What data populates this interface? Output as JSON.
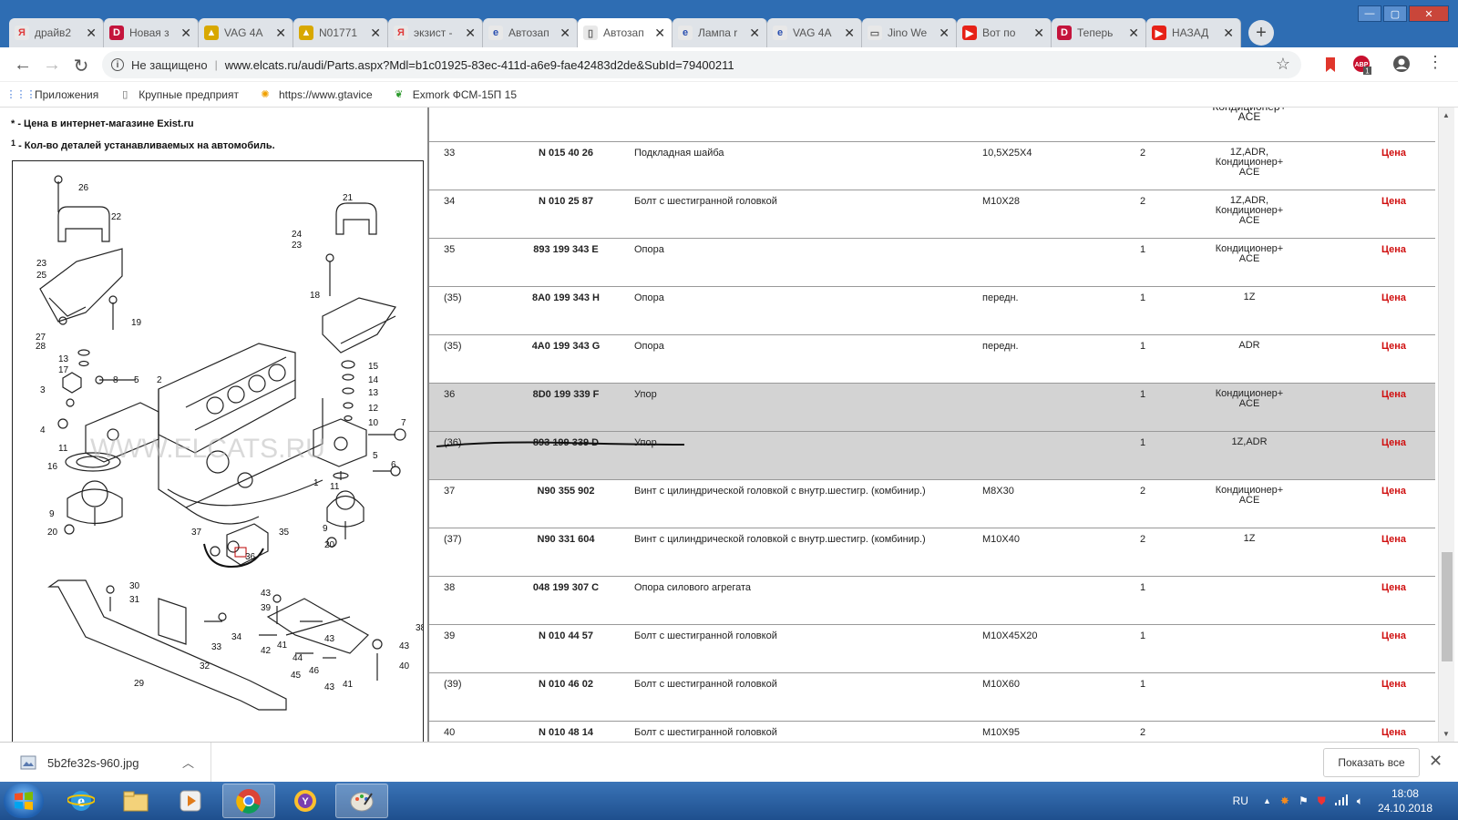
{
  "tabs": [
    {
      "title": "драйв2",
      "icon": "yandex-icon",
      "color": "#e8e8e8",
      "glyph": "Я",
      "glyph_color": "#e03a3a"
    },
    {
      "title": "Новая з",
      "icon": "drive2-icon",
      "color": "#c4143c",
      "glyph": "D"
    },
    {
      "title": "VAG 4A",
      "icon": "folder-photo-icon",
      "color": "#d8a800",
      "glyph": "▲"
    },
    {
      "title": "N01771",
      "icon": "folder-photo-icon",
      "color": "#d8a800",
      "glyph": "▲"
    },
    {
      "title": "экзист -",
      "icon": "yandex-icon",
      "color": "#e8e8e8",
      "glyph": "Я",
      "glyph_color": "#e03a3a"
    },
    {
      "title": "Автозап",
      "icon": "elcats-icon",
      "color": "#e8e8e8",
      "glyph": "e",
      "glyph_color": "#2a4fb0"
    },
    {
      "title": "Автозап",
      "icon": "page-icon",
      "color": "#e8e8e8",
      "glyph": "▯",
      "glyph_color": "#666",
      "active": true
    },
    {
      "title": "Лампа r",
      "icon": "elcats-icon",
      "color": "#e8e8e8",
      "glyph": "e",
      "glyph_color": "#2a4fb0"
    },
    {
      "title": "VAG 4A",
      "icon": "elcats-icon",
      "color": "#e8e8e8",
      "glyph": "e",
      "glyph_color": "#2a4fb0"
    },
    {
      "title": "Jino We",
      "icon": "page-icon",
      "color": "#e8e8e8",
      "glyph": "▭",
      "glyph_color": "#666"
    },
    {
      "title": "Вот по",
      "icon": "youtube-icon",
      "color": "#e62117",
      "glyph": "▶"
    },
    {
      "title": "Теперь",
      "icon": "drive2-icon",
      "color": "#c4143c",
      "glyph": "D"
    },
    {
      "title": "НАЗАД",
      "icon": "youtube-icon",
      "color": "#e62117",
      "glyph": "▶"
    }
  ],
  "address": {
    "security": "Не защищено",
    "url": "www.elcats.ru/audi/Parts.aspx?Mdl=b1c01925-83ec-411d-a6e9-fae42483d2de&SubId=79400211"
  },
  "bookmarks": [
    {
      "label": "Приложения",
      "icon": "apps-grid-icon"
    },
    {
      "label": "Крупные предприят",
      "icon": "page-icon"
    },
    {
      "label": "https://www.gtavice",
      "icon": "gtavice-icon"
    },
    {
      "label": "Exmork ФСМ-15П 15",
      "icon": "plant-icon"
    }
  ],
  "notes": {
    "n1_marker": "*",
    "n1_text": " - Цена в интернет-магазине Exist.ru",
    "n2_marker": "1",
    "n2_text": " - Кол-во деталей устанавливаемых на автомобиль."
  },
  "diagram": {
    "watermark": "WWW.ELCATS.RU",
    "labels": [
      "26",
      "22",
      "21",
      "24",
      "23",
      "23",
      "25",
      "18",
      "19",
      "27",
      "28",
      "13",
      "17",
      "15",
      "14",
      "13",
      "12",
      "10",
      "8",
      "5",
      "2",
      "3",
      "4",
      "11",
      "16",
      "9",
      "20",
      "7",
      "5",
      "6",
      "1",
      "11",
      "9",
      "20",
      "37",
      "35",
      "36",
      "30",
      "31",
      "34",
      "33",
      "32",
      "29",
      "43",
      "39",
      "41",
      "42",
      "43",
      "44",
      "45",
      "46",
      "43",
      "41",
      "38",
      "43",
      "40"
    ]
  },
  "prev_row": {
    "model": "Кондиционер+ ACE"
  },
  "rows": [
    {
      "num": "33",
      "part": "N 015 40 26",
      "name": "Подкладная шайба",
      "note": "10,5X25X4",
      "qty": "2",
      "model": [
        "1Z,ADR,",
        "Кондиционер+",
        "ACE"
      ],
      "price": "Цена"
    },
    {
      "num": "34",
      "part": "N 010 25 87",
      "name": "Болт с шестигранной головкой",
      "note": "M10X28",
      "qty": "2",
      "model": [
        "1Z,ADR,",
        "Кондиционер+",
        "ACE"
      ],
      "price": "Цена"
    },
    {
      "num": "35",
      "part": "893 199 343 E",
      "name": "Опора",
      "note": "",
      "qty": "1",
      "model": [
        "Кондиционер+",
        "ACE"
      ],
      "price": "Цена"
    },
    {
      "num": "(35)",
      "part": "8A0 199 343 H",
      "name": "Опора",
      "note": "передн.",
      "qty": "1",
      "model": [
        "1Z"
      ],
      "price": "Цена"
    },
    {
      "num": "(35)",
      "part": "4A0 199 343 G",
      "name": "Опора",
      "note": "передн.",
      "qty": "1",
      "model": [
        "ADR"
      ],
      "price": "Цена"
    },
    {
      "num": "36",
      "part": "8D0 199 339 F",
      "name": "Упор",
      "note": "",
      "qty": "1",
      "model": [
        "Кондиционер+",
        "ACE"
      ],
      "price": "Цена",
      "highlight": true
    },
    {
      "num": "(36)",
      "part": "893 199 339 D",
      "name": "Упор",
      "note": "",
      "qty": "1",
      "model": [
        "1Z,ADR"
      ],
      "price": "Цена",
      "highlight": true
    },
    {
      "num": "37",
      "part": "N90 355 902",
      "name": "Винт с цилиндрической головкой с внутр.шестигр. (комбинир.)",
      "note": "M8X30",
      "qty": "2",
      "model": [
        "Кондиционер+",
        "ACE"
      ],
      "price": "Цена"
    },
    {
      "num": "(37)",
      "part": "N90 331 604",
      "name": "Винт с цилиндрической головкой с внутр.шестигр. (комбинир.)",
      "note": "M10X40",
      "qty": "2",
      "model": [
        "1Z"
      ],
      "price": "Цена"
    },
    {
      "num": "38",
      "part": "048 199 307 C",
      "name": "Опора силового агрегата",
      "note": "",
      "qty": "1",
      "model": [],
      "price": "Цена"
    },
    {
      "num": "39",
      "part": "N 010 44 57",
      "name": "Болт с шестигранной головкой",
      "note": "M10X45X20",
      "qty": "1",
      "model": [],
      "price": "Цена"
    },
    {
      "num": "(39)",
      "part": "N 010 46 02",
      "name": "Болт с шестигранной головкой",
      "note": "M10X60",
      "qty": "1",
      "model": [],
      "price": "Цена"
    },
    {
      "num": "40",
      "part": "N 010 48 14",
      "name": "Болт с шестигранной головкой",
      "note": "M10X95",
      "qty": "2",
      "model": [],
      "price": "Цена"
    }
  ],
  "download": {
    "filename": "5b2fe32s-960.jpg",
    "show_all": "Показать все"
  },
  "taskbar": {
    "lang": "RU",
    "time": "18:08",
    "date": "24.10.2018"
  }
}
